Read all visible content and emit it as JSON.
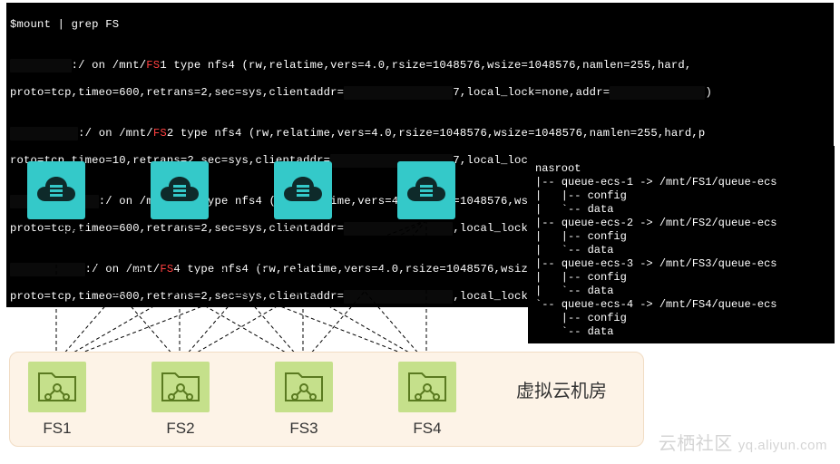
{
  "terminal_top": {
    "cmd": "$mount | grep FS",
    "common_opts_a": "type nfs4 (rw,relatime,vers=4.0,rsize=1048576,wsize=1048576,namlen=255,hard,",
    "common_opts_b": "type nfs4 (rw,relatime,vers=4.0,rsize=1048576,wsize=1048576,namlen=255,hard,p",
    "opts_tail_a": "proto=tcp,timeo=600,retrans=2,sec=sys,clientaddr=",
    "opts_tail_b": "roto=tcp,timeo=10,retrans=2,sec=sys,clientaddr=",
    "opts_tail_c": "proto=tcp,timeo=600,retrans=2,sec=sys,clientaddr=",
    "opts_tail_d": "proto=tcp,timeo=600,retrans=2,sec=sys,clientaddr=",
    "lock_tail": ",local_lock=none,addr=",
    "lock_tail7": "7,local_lock=none,addr=",
    "close": ")",
    "on": "on",
    "mnt": "/mnt/",
    "mounts": [
      {
        "fs": "FS",
        "n": "1"
      },
      {
        "fs": "FS",
        "n": "2"
      },
      {
        "fs": "FS",
        "n": "3"
      },
      {
        "fs": "FS",
        "n": "4"
      }
    ]
  },
  "tree": {
    "root": "nasroot",
    "items": [
      {
        "name": "queue-ecs-1",
        "target": "/mnt/FS1/queue-ecs"
      },
      {
        "name": "queue-ecs-2",
        "target": "/mnt/FS2/queue-ecs"
      },
      {
        "name": "queue-ecs-3",
        "target": "/mnt/FS3/queue-ecs"
      },
      {
        "name": "queue-ecs-4",
        "target": "/mnt/FS4/queue-ecs"
      }
    ],
    "sub_config": "config",
    "sub_data": "data"
  },
  "diagram": {
    "fs_labels": [
      "FS1",
      "FS2",
      "FS3",
      "FS4"
    ],
    "box_title": "虚拟云机房"
  },
  "watermark": {
    "main": "云栖社区",
    "url": "yq.aliyun.com"
  }
}
